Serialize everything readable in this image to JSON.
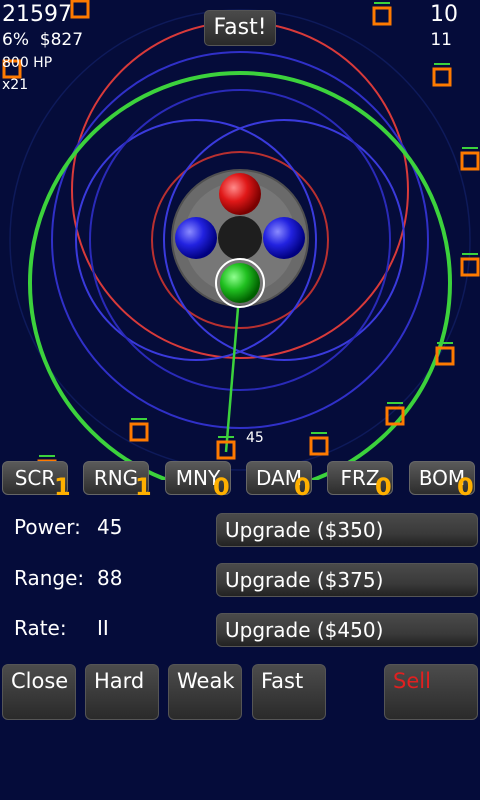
{
  "hud": {
    "score": "21597",
    "percent": "6%",
    "money": "$827",
    "hp": "800 HP",
    "multiplier": "x21",
    "wave": "10",
    "enemies_left": "11"
  },
  "speed_button": "Fast!",
  "damage_popup": "45",
  "tower_types": [
    {
      "label": "SCR",
      "count": "1"
    },
    {
      "label": "RNG",
      "count": "1"
    },
    {
      "label": "MNY",
      "count": "0"
    },
    {
      "label": "DAM",
      "count": "0"
    },
    {
      "label": "FRZ",
      "count": "0"
    },
    {
      "label": "BOM",
      "count": "0"
    }
  ],
  "stats": {
    "power": {
      "label": "Power:",
      "value": "45",
      "upgrade": "Upgrade ($350)"
    },
    "range": {
      "label": "Range:",
      "value": "88",
      "upgrade": "Upgrade ($375)"
    },
    "rate": {
      "label": "Rate:",
      "value": "II",
      "upgrade": "Upgrade ($450)"
    }
  },
  "actions": {
    "close": "Close",
    "hard": "Hard",
    "weak": "Weak",
    "fast": "Fast",
    "sell": "Sell"
  },
  "colors": {
    "background": "#050c3a",
    "range_green": "#3cd23c",
    "ring_red": "#d83a3a",
    "ring_blue": "#3a3adc",
    "enemy_orange": "#ff7a00",
    "count_orange": "#ffb000",
    "sell_red": "#e02020"
  }
}
